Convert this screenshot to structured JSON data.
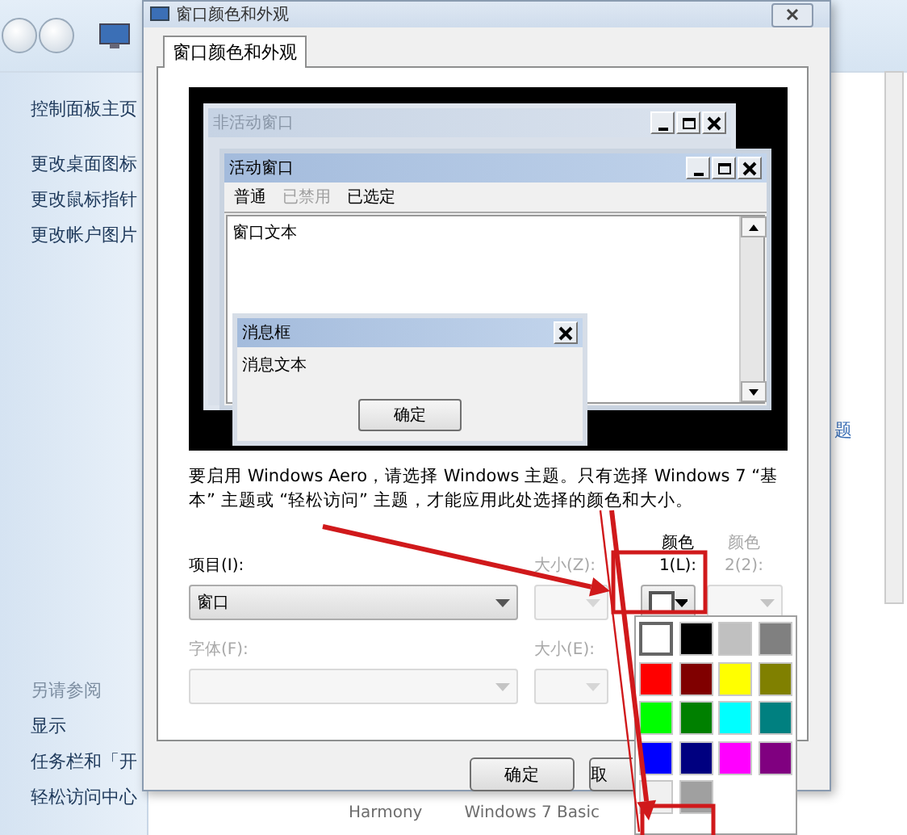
{
  "background": {
    "sidebar_links": [
      "控制面板主页",
      "更改桌面图标",
      "更改鼠标指针",
      "更改帐户图片"
    ],
    "see_also": {
      "heading": "另请参阅",
      "links": [
        "显示",
        "任务栏和「开",
        "轻松访问中心"
      ]
    },
    "themes": [
      "Harmony",
      "Windows 7 Basic"
    ],
    "right_pane_link": "题"
  },
  "dialog": {
    "title": "窗口颜色和外观",
    "tabs": [
      {
        "label": "窗口颜色和外观",
        "selected": true
      }
    ],
    "preview": {
      "inactive_title": "非活动窗口",
      "active_title": "活动窗口",
      "menu": [
        {
          "label": "普通",
          "disabled": false
        },
        {
          "label": "已禁用",
          "disabled": true
        },
        {
          "label": "已选定",
          "disabled": false
        }
      ],
      "window_text": "窗口文本",
      "message_title": "消息框",
      "message_text": "消息文本",
      "message_button": "确定"
    },
    "description": "要启用 Windows Aero，请选择 Windows 主题。只有选择 Windows 7 “基本” 主题或 “轻松访问” 主题，才能应用此处选择的颜色和大小。",
    "field_rows": [
      [
        {
          "kind": "dropdown",
          "label": "项目(I):",
          "value": "窗口",
          "disabled": false
        },
        {
          "kind": "spin",
          "label": "大小(Z):",
          "disabled": true
        },
        {
          "kind": "color",
          "label": "颜色1(L):",
          "color": "#ffffff",
          "disabled": false
        },
        {
          "kind": "dropdown",
          "label": "颜色2(2):",
          "disabled": true
        }
      ],
      [
        {
          "kind": "dropdown",
          "label": "字体(F):",
          "disabled": true
        },
        {
          "kind": "spin",
          "label": "大小(E):",
          "disabled": true
        }
      ]
    ],
    "buttons": [
      "确定",
      "取"
    ]
  },
  "color_palette": {
    "swatches": [
      {
        "color": "#ffffff",
        "selected": true
      },
      {
        "color": "#000000",
        "selected": false
      },
      {
        "color": "#c0c0c0",
        "selected": false
      },
      {
        "color": "#808080",
        "selected": false
      },
      {
        "color": "#ff0000",
        "selected": false
      },
      {
        "color": "#800000",
        "selected": false
      },
      {
        "color": "#ffff00",
        "selected": false
      },
      {
        "color": "#808000",
        "selected": false
      },
      {
        "color": "#00ff00",
        "selected": false
      },
      {
        "color": "#008000",
        "selected": false
      },
      {
        "color": "#00ffff",
        "selected": false
      },
      {
        "color": "#008080",
        "selected": false
      },
      {
        "color": "#0000ff",
        "selected": false
      },
      {
        "color": "#000080",
        "selected": false
      },
      {
        "color": "#ff00ff",
        "selected": false
      },
      {
        "color": "#800080",
        "selected": false
      },
      {
        "color": "#f0f0f0",
        "selected": false
      },
      {
        "color": "#a0a0a0",
        "selected": false
      }
    ]
  }
}
